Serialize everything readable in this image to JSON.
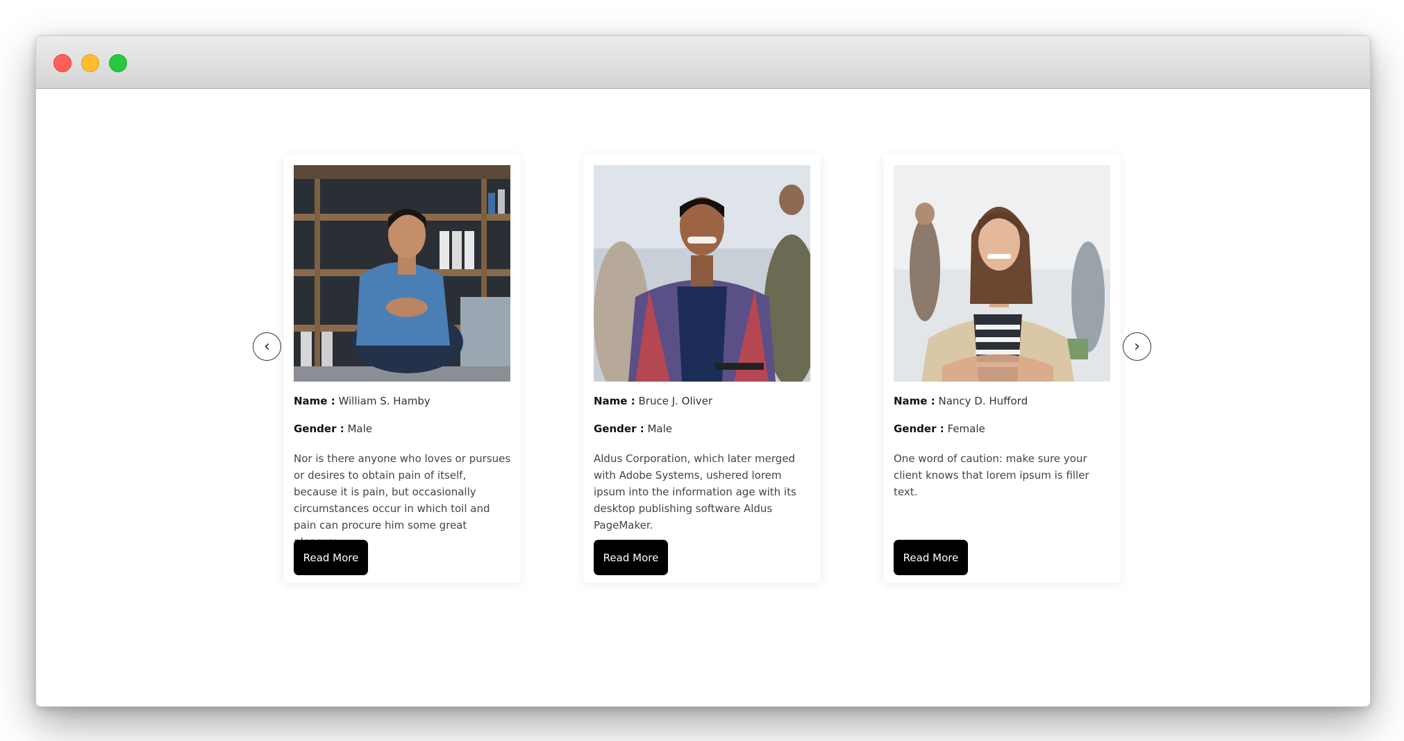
{
  "window": {
    "controls": [
      "close",
      "minimize",
      "zoom"
    ],
    "colors": {
      "close": "#ff5f57",
      "minimize": "#febc2e",
      "zoom": "#28c840"
    }
  },
  "carousel": {
    "prev_icon": "‹",
    "next_icon": "›"
  },
  "labels": {
    "name": "Name :",
    "gender": "Gender :"
  },
  "cards": [
    {
      "name": "William S. Hamby",
      "gender": "Male",
      "description": "Nor is there anyone who loves or pursues or desires to obtain pain of itself, because it is pain, but occasionally circumstances occur in which toil and pain can procure him some great pleasure.",
      "button": "Read More"
    },
    {
      "name": "Bruce J. Oliver",
      "gender": "Male",
      "description": "Aldus Corporation, which later merged with Adobe Systems, ushered lorem ipsum into the information age with its desktop publishing software Aldus PageMaker.",
      "button": "Read More"
    },
    {
      "name": "Nancy D. Hufford",
      "gender": "Female",
      "description": "One word of caution: make sure your client knows that lorem ipsum is filler text.",
      "button": "Read More"
    }
  ]
}
